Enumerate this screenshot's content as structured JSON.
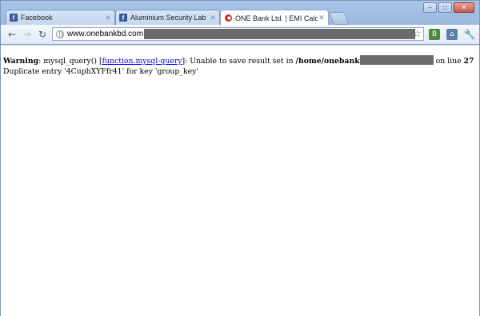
{
  "browser": {
    "tabs": [
      {
        "title": "Facebook",
        "favicon": "facebook-icon",
        "active": false
      },
      {
        "title": "Aluminium Security Lab",
        "favicon": "facebook-icon",
        "active": false
      },
      {
        "title": "ONE Bank Ltd. | EMI Calculato",
        "favicon": "onebank-icon",
        "active": true
      }
    ],
    "close_glyph": "✕",
    "window_controls": {
      "minimize": "–",
      "maximize": "□",
      "close": "✕"
    },
    "nav": {
      "back": "←",
      "forward": "→",
      "reload": "↻"
    },
    "omnibox": {
      "url": "www.onebankbd.com",
      "star": "☆"
    },
    "extensions": {
      "ext1": "B",
      "ext2": "⌂"
    },
    "wrench": "🔧"
  },
  "page": {
    "line1": {
      "warning_label": "Warning",
      "text_a": ": mysql_query() [",
      "link": "function.mysql-query",
      "text_b": "]: Unable to save result set in ",
      "path": "/home/onebank",
      "text_c": " on line ",
      "line_number": "27"
    },
    "line2": "Duplicate entry '4CuphXYFfr41' for key 'group_key'"
  },
  "colors": {
    "chrome_frame": "#bcd3ee",
    "redaction": "#6b6b6b",
    "link": "#0000ee"
  }
}
